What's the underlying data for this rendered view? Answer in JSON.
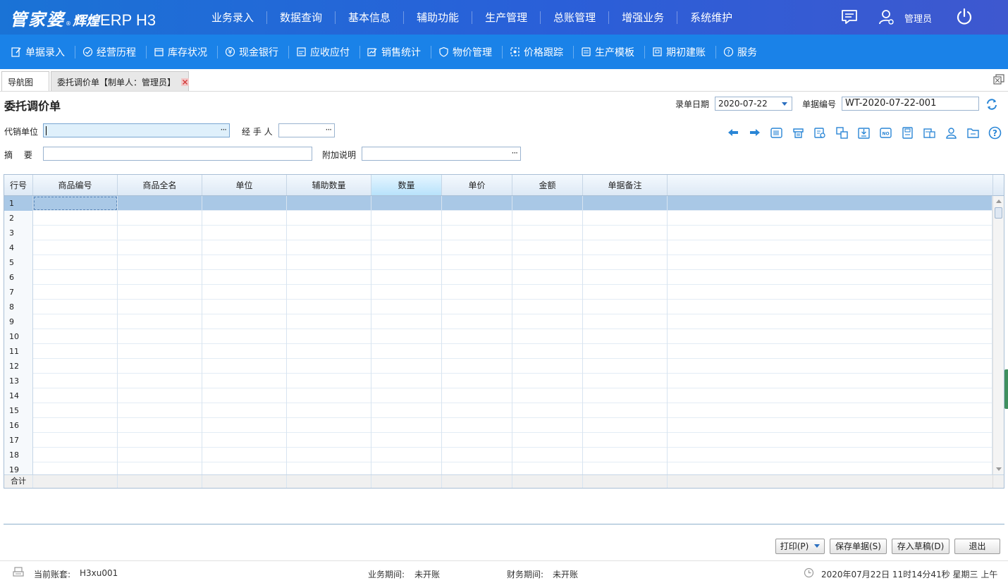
{
  "header": {
    "brand": "管家婆",
    "brand_mark": "®",
    "sub": "辉煌",
    "product": "ERP H3",
    "menu": [
      "业务录入",
      "数据查询",
      "基本信息",
      "辅助功能",
      "生产管理",
      "总账管理",
      "增强业务",
      "系统维护"
    ],
    "user_name": "管理员"
  },
  "quickbar": [
    {
      "label": "单据录入",
      "icon": "edit-icon"
    },
    {
      "label": "经营历程",
      "icon": "check-circle-icon"
    },
    {
      "label": "库存状况",
      "icon": "box-icon"
    },
    {
      "label": "现金银行",
      "icon": "yuan-icon"
    },
    {
      "label": "应收应付",
      "icon": "ledger-icon"
    },
    {
      "label": "销售统计",
      "icon": "chart-edit-icon"
    },
    {
      "label": "物价管理",
      "icon": "shield-icon"
    },
    {
      "label": "价格跟踪",
      "icon": "track-icon"
    },
    {
      "label": "生产模板",
      "icon": "template-icon"
    },
    {
      "label": "期初建账",
      "icon": "account-icon"
    },
    {
      "label": "服务",
      "icon": "help-icon"
    }
  ],
  "tabs": [
    {
      "label": "导航图"
    },
    {
      "label": "委托调价单【制单人：管理员】"
    }
  ],
  "form": {
    "title": "委托调价单",
    "date_label": "录单日期",
    "date_value": "2020-07-22",
    "number_label": "单据编号",
    "number_value": "WT-2020-07-22-001",
    "agent_label": "代销单位",
    "agent_value": "",
    "handler_label": "经 手 人",
    "handler_value": "",
    "summary_label": "摘　 要",
    "summary_value": "",
    "note_label": "附加说明",
    "note_value": "",
    "dots": "···"
  },
  "grid": {
    "columns": [
      "行号",
      "商品编号",
      "商品全名",
      "单位",
      "辅助数量",
      "数量",
      "单价",
      "金额",
      "单据备注"
    ],
    "active_column": "数量",
    "rows": [
      "1",
      "2",
      "3",
      "4",
      "5",
      "6",
      "7",
      "8",
      "9",
      "10",
      "11",
      "12",
      "13",
      "14",
      "15",
      "16",
      "17",
      "18",
      "19"
    ],
    "selected_row": "1",
    "footer_label": "合计"
  },
  "buttons": {
    "print": "打印(P)",
    "save": "保存单据(S)",
    "draft": "存入草稿(D)",
    "exit": "退出"
  },
  "status": {
    "account_label": "当前账套:",
    "account_value": "H3xu001",
    "biz_label": "业务期间:",
    "biz_value": "未开账",
    "fin_label": "财务期间:",
    "fin_value": "未开账",
    "datetime": "2020年07月22日 11时14分41秒 星期三 上午"
  },
  "colors": {
    "header_bg": "#1a73d6",
    "quickbar_bg": "#1a82e8",
    "selected_row": "#a9c8e6",
    "active_column": "#b8e2fb"
  }
}
